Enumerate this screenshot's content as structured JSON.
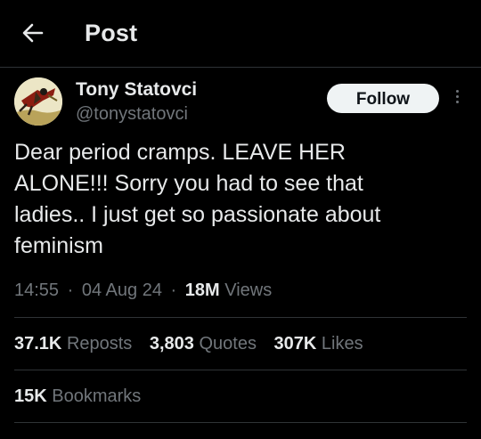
{
  "header": {
    "back_icon": "arrow-left-icon",
    "title": "Post"
  },
  "author": {
    "display_name": "Tony Statovci",
    "handle": "@tonystatovci",
    "avatar_icon": "profile-avatar"
  },
  "follow_button": {
    "label": "Follow"
  },
  "more_icon": "more-vertical-icon",
  "tweet": {
    "lines": [
      "Dear period cramps. LEAVE HER",
      "ALONE!!! Sorry you had to see that",
      "ladies.. I just get so passionate about",
      "feminism"
    ]
  },
  "meta": {
    "time": "14:55",
    "separator": "·",
    "date": "04 Aug 24",
    "views_count": "18M",
    "views_label": "Views"
  },
  "stats": {
    "reposts_count": "37.1K",
    "reposts_label": "Reposts",
    "quotes_count": "3,803",
    "quotes_label": "Quotes",
    "likes_count": "307K",
    "likes_label": "Likes",
    "bookmarks_count": "15K",
    "bookmarks_label": "Bookmarks"
  },
  "colors": {
    "background": "#000000",
    "primary_text": "#e7e9ea",
    "secondary_text": "#71767b",
    "divider": "#2f3336",
    "button_bg": "#eff3f4"
  }
}
